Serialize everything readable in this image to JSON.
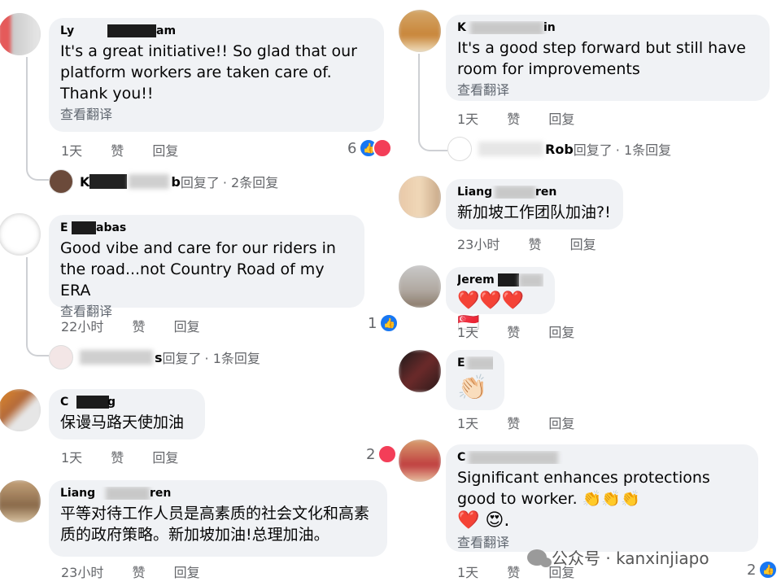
{
  "comments_left": [
    {
      "author": "Ly",
      "author_tail": "am",
      "text": "It's a great initiative!! So glad that our platform workers are taken care of.  Thank you!!",
      "translate": "查看翻译",
      "time": "1天",
      "like": "赞",
      "reply": "回复",
      "reaction_count": "6",
      "reply_summary": {
        "name_tail": "b",
        "replied": "回复了",
        "count": "· 2条回复",
        "name_head": "K"
      }
    },
    {
      "author": "E",
      "author_tail": "abas",
      "text": "Good vibe and care for our riders in the road...not Country Road of my ERA",
      "translate": "查看翻译",
      "time": "22小时",
      "like": "赞",
      "reply": "回复",
      "reaction_count": "1",
      "reply_summary": {
        "name_tail": "s",
        "replied": "回复了",
        "count": "· 1条回复"
      }
    },
    {
      "author": "C",
      "author_tail": "g",
      "text": "保谩马路天使加油",
      "time": "1天",
      "like": "赞",
      "reply": "回复",
      "reaction_count": "2"
    },
    {
      "author": "Liang",
      "author_tail": "ren",
      "text": "平等对待工作人员是高素质的社会文化和高素质的政府策略。新加坡加油!总理加油。",
      "time": "23小时",
      "like": "赞",
      "reply": "回复"
    }
  ],
  "comments_right": [
    {
      "author": "K",
      "author_tail": "in",
      "text": "It's a good step forward but still have room for improvements",
      "translate": "查看翻译",
      "time": "1天",
      "like": "赞",
      "reply": "回复",
      "reply_summary": {
        "name": "Rob",
        "replied": "回复了",
        "count": "· 1条回复"
      }
    },
    {
      "author": "Liang",
      "author_tail": "ren",
      "text": "新加坡工作团队加油?!",
      "time": "23小时",
      "like": "赞",
      "reply": "回复"
    },
    {
      "author": "Jerem",
      "author_tail": "",
      "text": "❤️❤️❤️🇸🇬",
      "time": "1天",
      "like": "赞",
      "reply": "回复"
    },
    {
      "author": "E",
      "author_tail": "",
      "text": "👏🏻",
      "time": "1天",
      "like": "赞",
      "reply": "回复"
    },
    {
      "author": "C",
      "author_tail": "",
      "text": "Significant enhances protections good to worker. 👏👏👏",
      "text2": "❤️ 😍.",
      "translate": "查看翻译",
      "time": "1天",
      "like": "赞",
      "reply": "回复",
      "reaction_count": "2"
    }
  ],
  "watermark": {
    "text": "公众号 · kanxinjiapo"
  },
  "colors": {
    "bubble": "#f0f2f5",
    "like_blue": "#1877f2",
    "love_red": "#f33e58",
    "meta_gray": "#65676b"
  }
}
